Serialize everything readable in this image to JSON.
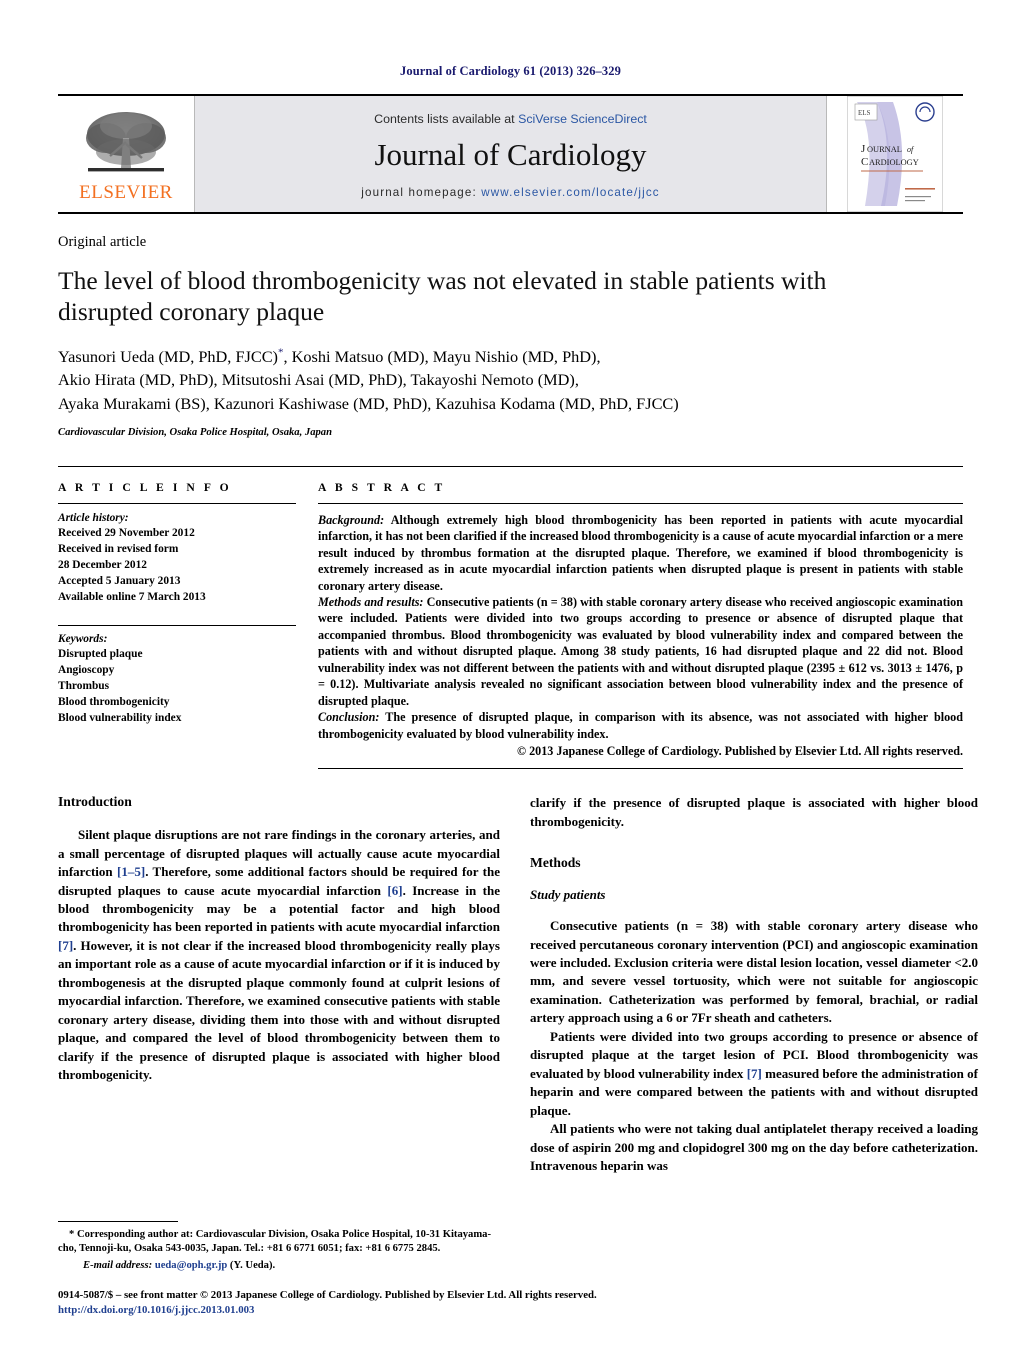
{
  "running_head": "Journal of Cardiology 61 (2013) 326–329",
  "masthead": {
    "contents_prefix": "Contents lists available at ",
    "sciencedirect": "SciVerse ScienceDirect",
    "journal_name": "Journal of Cardiology",
    "homepage_prefix": "journal homepage: ",
    "homepage_url": "www.elsevier.com/locate/jjcc",
    "publisher_logo_text": "ELSEVIER",
    "publisher_logo_color": "#F37021",
    "cover_title_line1": "JOURNAL of",
    "cover_title_line2": "CARDIOLOGY",
    "link_color": "#2b57a4"
  },
  "article": {
    "type": "Original article",
    "title": "The level of blood thrombogenicity was not elevated in stable patients with disrupted coronary plaque",
    "authors": "Yasunori Ueda (MD, PhD, FJCC)*, Koshi Matsuo (MD), Mayu Nishio (MD, PhD), Akio Hirata (MD, PhD), Mitsutoshi Asai (MD, PhD), Takayoshi Nemoto (MD), Ayaka Murakami (BS), Kazunori Kashiwase (MD, PhD), Kazuhisa Kodama (MD, PhD, FJCC)",
    "authors_line1": "Yasunori Ueda (MD, PhD, FJCC)",
    "authors_line1_rest": ", Koshi Matsuo (MD), Mayu Nishio (MD, PhD),",
    "authors_line2": "Akio Hirata (MD, PhD), Mitsutoshi Asai (MD, PhD), Takayoshi Nemoto (MD),",
    "authors_line3": "Ayaka Murakami (BS), Kazunori Kashiwase (MD, PhD), Kazuhisa Kodama (MD, PhD, FJCC)",
    "corresponding_marker": "*",
    "affiliation": "Cardiovascular Division, Osaka Police Hospital, Osaka, Japan"
  },
  "article_info": {
    "heading": "A R T I C L E   I N F O",
    "history_label": "Article history:",
    "history": [
      "Received 29 November 2012",
      "Received in revised form",
      "28 December 2012",
      "Accepted 5 January 2013",
      "Available online 7 March 2013"
    ],
    "keywords_label": "Keywords:",
    "keywords": [
      "Disrupted plaque",
      "Angioscopy",
      "Thrombus",
      "Blood thrombogenicity",
      "Blood vulnerability index"
    ]
  },
  "abstract": {
    "heading": "A B S T R A C T",
    "background_label": "Background:",
    "background_text": " Although extremely high blood thrombogenicity has been reported in patients with acute myocardial infarction, it has not been clarified if the increased blood thrombogenicity is a cause of acute myocardial infarction or a mere result induced by thrombus formation at the disrupted plaque. Therefore, we examined if blood thrombogenicity is extremely increased as in acute myocardial infarction patients when disrupted plaque is present in patients with stable coronary artery disease.",
    "methods_label": "Methods and results:",
    "methods_text": " Consecutive patients (n = 38) with stable coronary artery disease who received angioscopic examination were included. Patients were divided into two groups according to presence or absence of disrupted plaque that accompanied thrombus. Blood thrombogenicity was evaluated by blood vulnerability index and compared between the patients with and without disrupted plaque. Among 38 study patients, 16 had disrupted plaque and 22 did not. Blood vulnerability index was not different between the patients with and without disrupted plaque (2395 ± 612 vs. 3013 ± 1476, p = 0.12). Multivariate analysis revealed no significant association between blood vulnerability index and the presence of disrupted plaque.",
    "conclusion_label": "Conclusion:",
    "conclusion_text": " The presence of disrupted plaque, in comparison with its absence, was not associated with higher blood thrombogenicity evaluated by blood vulnerability index.",
    "copyright": "© 2013 Japanese College of Cardiology. Published by Elsevier Ltd. All rights reserved."
  },
  "body": {
    "introduction_heading": "Introduction",
    "intro_p1_a": "Silent plaque disruptions are not rare findings in the coronary arteries, and a small percentage of disrupted plaques will actually cause acute myocardial infarction ",
    "intro_ref_1_5": "[1–5]",
    "intro_p1_b": ". Therefore, some additional factors should be required for the disrupted plaques to cause acute myocardial infarction ",
    "intro_ref_6": "[6]",
    "intro_p1_c": ". Increase in the blood thrombogenicity may be a potential factor and high blood thrombogenicity has been reported in patients with acute myocardial infarction ",
    "intro_ref_7": "[7]",
    "intro_p1_d": ". However, it is not clear if the increased blood thrombogenicity really plays an important role as a cause of acute myocardial infarction or if it is induced by thrombogenesis at the disrupted plaque commonly found at culprit lesions of myocardial infarction. Therefore, we examined consecutive patients with stable coronary artery disease, dividing them into those with and without disrupted plaque, and compared the level of blood thrombogenicity between them to clarify if the presence of disrupted plaque is associated with higher blood thrombogenicity.",
    "intro_continuation": "clarify if the presence of disrupted plaque is associated with higher blood thrombogenicity.",
    "methods_heading": "Methods",
    "study_patients_heading": "Study patients",
    "methods_p1": "Consecutive patients (n = 38) with stable coronary artery disease who received percutaneous coronary intervention (PCI) and angioscopic examination were included. Exclusion criteria were distal lesion location, vessel diameter <2.0 mm, and severe vessel tortuosity, which were not suitable for angioscopic examination. Catheterization was performed by femoral, brachial, or radial artery approach using a 6 or 7Fr sheath and catheters.",
    "methods_p2_a": "Patients were divided into two groups according to presence or absence of disrupted plaque at the target lesion of PCI. Blood thrombogenicity was evaluated by blood vulnerability index ",
    "methods_p2_ref": "[7]",
    "methods_p2_b": " measured before the administration of heparin and were compared between the patients with and without disrupted plaque.",
    "methods_p3": "All patients who were not taking dual antiplatelet therapy received a loading dose of aspirin 200 mg and clopidogrel 300 mg on the day before catheterization. Intravenous heparin was"
  },
  "footnote": {
    "marker": "*",
    "corresponding": " Corresponding author at: Cardiovascular Division, Osaka Police Hospital, 10-31 Kitayama-cho, Tennoji-ku, Osaka 543-0035, Japan. Tel.: +81 6 6771 6051; fax: +81 6 6775 2845.",
    "email_label": "E-mail address:",
    "email": "ueda@oph.gr.jp",
    "email_suffix": " (Y. Ueda)."
  },
  "footer": {
    "issn_line": "0914-5087/$ – see front matter © 2013 Japanese College of Cardiology. Published by Elsevier Ltd. All rights reserved.",
    "doi": "http://dx.doi.org/10.1016/j.jjcc.2013.01.003"
  }
}
